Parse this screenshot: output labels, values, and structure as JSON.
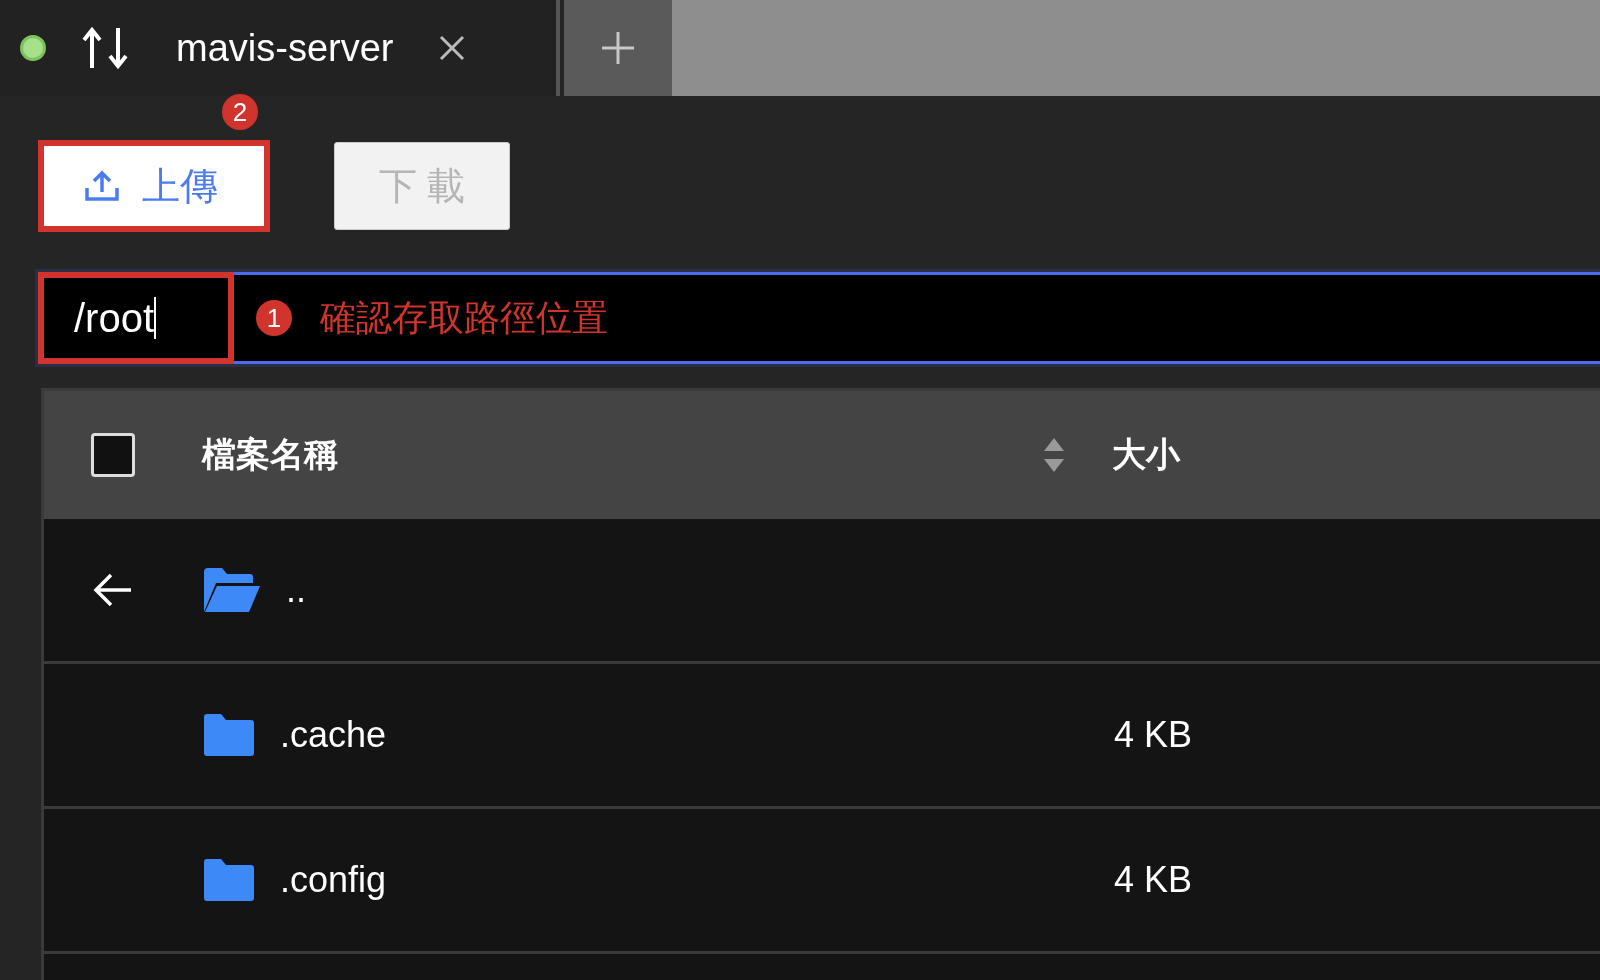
{
  "tab": {
    "title": "mavis-server",
    "connected": true
  },
  "toolbar": {
    "buttons": [
      {
        "label": "上傳",
        "kind": "upload",
        "disabled": false,
        "highlighted": true,
        "badge": "2"
      },
      {
        "label": "下 載",
        "kind": "download",
        "disabled": true,
        "highlighted": false
      }
    ]
  },
  "path_bar": {
    "value": "/root",
    "highlighted": true,
    "badge": "1",
    "note": "確認存取路徑位置"
  },
  "table": {
    "select_all": {
      "checked": false
    },
    "columns": [
      {
        "label": "檔案名稱",
        "sortable": true
      },
      {
        "label": "大小",
        "sortable": false
      }
    ],
    "rows": [
      {
        "kind": "parent",
        "name": ".."
      },
      {
        "kind": "folder",
        "name": ".cache",
        "size": "4 KB"
      },
      {
        "kind": "folder",
        "name": ".config",
        "size": "4 KB"
      },
      {
        "kind": "blank"
      }
    ]
  }
}
